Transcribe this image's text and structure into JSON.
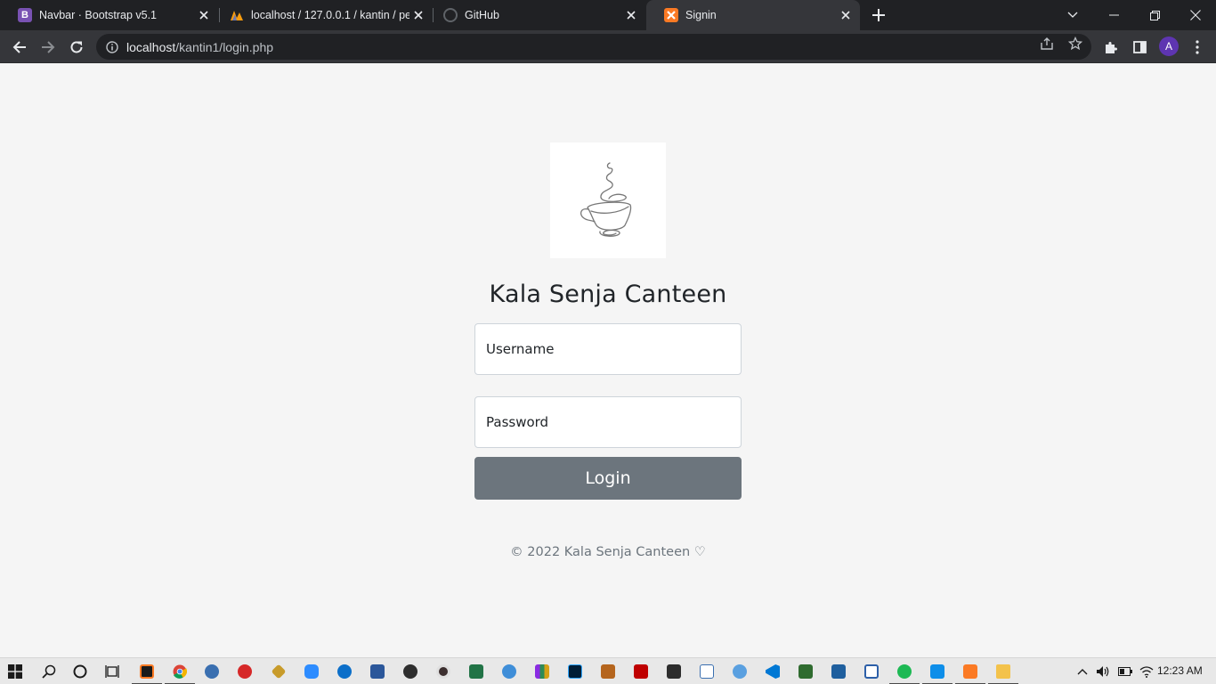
{
  "browser": {
    "tabs": [
      {
        "title": "Navbar · Bootstrap v5.1",
        "favicon": "bootstrap-icon",
        "active": false
      },
      {
        "title": "localhost / 127.0.0.1 / kantin / pe",
        "favicon": "phpmyadmin-icon",
        "active": false
      },
      {
        "title": "GitHub",
        "favicon": "github-icon",
        "active": false
      },
      {
        "title": "Signin",
        "favicon": "xampp-icon",
        "active": true
      }
    ],
    "url_host": "localhost",
    "url_path": "/kantin1/login.php",
    "profile_initial": "A"
  },
  "page": {
    "logo_icon": "coffee-cup-icon",
    "heading": "Kala Senja Canteen",
    "username_placeholder": "Username",
    "password_placeholder": "Password",
    "login_label": "Login",
    "footer": "© 2022 Kala Senja Canteen ♡"
  },
  "taskbar": {
    "clock": "12:23 AM",
    "apps": [
      "start-icon",
      "search-icon",
      "cortana-icon",
      "task-view-icon",
      "xampp-icon",
      "chrome-icon",
      "network-icon",
      "spider-icon",
      "tool-icon",
      "zoom-icon",
      "edge-icon",
      "word-icon",
      "arrow-icon",
      "media-icon",
      "excel-icon",
      "browser-icon",
      "winrar-icon",
      "lightroom-icon",
      "dosbox-icon",
      "filezilla-icon",
      "terminal-icon",
      "panel-icon",
      "globe-icon",
      "vscode-icon",
      "image-icon",
      "display-icon",
      "vpn-icon",
      "spotify-icon",
      "teamviewer-icon",
      "xampp-control-icon",
      "folder-icon"
    ]
  },
  "colors": {
    "page_bg": "#f5f5f5",
    "button_bg": "#6c757d",
    "heading": "#212529",
    "footer": "#6c757d",
    "chrome_dark": "#202124",
    "chrome_toolbar": "#35363a"
  }
}
